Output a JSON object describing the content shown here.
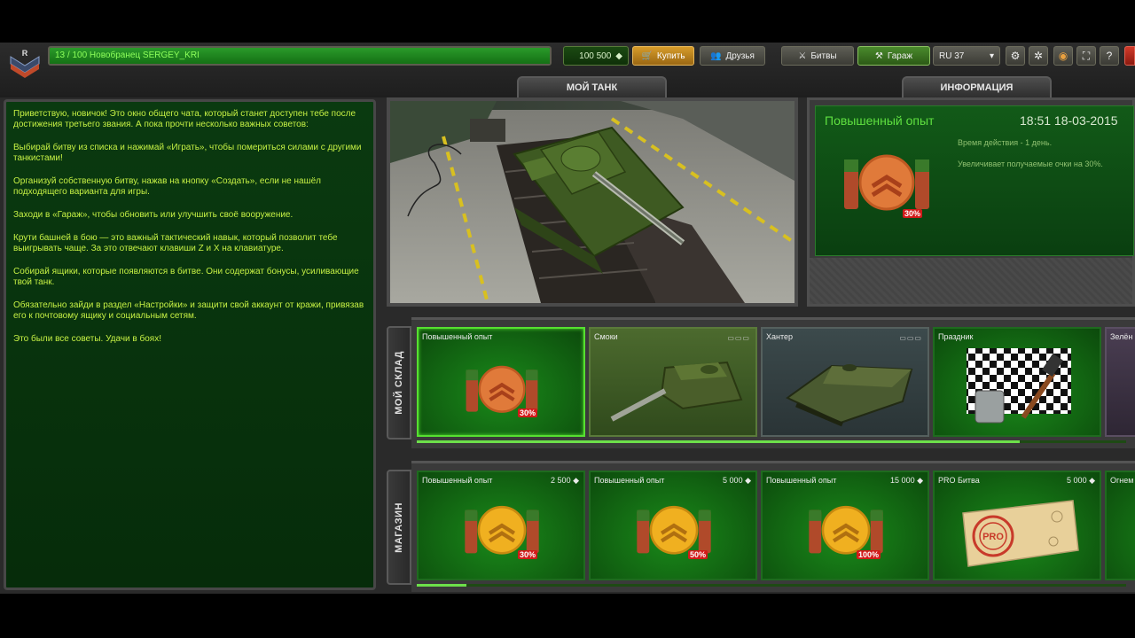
{
  "topbar": {
    "xp_text": "13 / 100   Новобранец SERGEY_KRI",
    "xp_progress": 0.13,
    "crystals": "100 500",
    "crystal_symbol": "◆",
    "buy_label": "Купить",
    "friends_label": "Друзья",
    "battles_label": "Битвы",
    "garage_label": "Гараж",
    "server_label": "RU 37",
    "help_label": "?"
  },
  "chat": {
    "lines": [
      "Приветствую, новичок! Это окно общего чата, который станет доступен тебе после достижения третьего звания. А пока прочти несколько важных советов:",
      "Выбирай битву из списка и нажимай «Играть», чтобы помериться силами с другими танкистами!",
      "Организуй собственную битву, нажав на кнопку «Создать», если не нашёл подходящего варианта для игры.",
      "Заходи в «Гараж», чтобы обновить или улучшить своё вооружение.",
      "Крути башней в бою — это важный тактический навык, который позволит тебе выигрывать чаще. За это отвечают клавиши Z и X на клавиатуре.",
      "Собирай ящики, которые появляются в битве. Они содержат бонусы, усиливающие твой танк.",
      "Обязательно зайди в раздел «Настройки» и защити свой аккаунт от кражи, привязав его к почтовому ящику и социальным сетям.",
      "Это были все советы. Удачи в боях!"
    ]
  },
  "tabs": {
    "my_tank": "МОЙ ТАНК",
    "info": "ИНФОРМАЦИЯ",
    "warehouse": "МОЙ СКЛАД",
    "shop": "МАГАЗИН"
  },
  "info": {
    "title": "Повышенный опыт",
    "time": "18:51  18-03-2015",
    "duration": "Время действия - 1 день.",
    "description": "Увеличивает получаемые очки на 30%.",
    "badge": "30%"
  },
  "warehouse": {
    "items": [
      {
        "name": "Повышенный опыт",
        "badge": "30%"
      },
      {
        "name": "Смоки",
        "dots": "▭▭▭"
      },
      {
        "name": "Хантер",
        "dots": "▭▭▭"
      },
      {
        "name": "Праздник"
      },
      {
        "name": "Зелён"
      }
    ],
    "scroll_progress": 0.85
  },
  "shop": {
    "items": [
      {
        "name": "Повышенный опыт",
        "price": "2 500",
        "badge": "30%"
      },
      {
        "name": "Повышенный опыт",
        "price": "5 000",
        "badge": "50%"
      },
      {
        "name": "Повышенный опыт",
        "price": "15 000",
        "badge": "100%"
      },
      {
        "name": "PRO Битва",
        "price": "5 000"
      },
      {
        "name": "Огнем"
      }
    ],
    "scroll_progress": 0.07
  },
  "colors": {
    "chat_text": "#c5f044",
    "accent_green": "#56e030",
    "buy_orange": "#d79c2a",
    "badge_red": "#d21a1a"
  },
  "icons": [
    "rank-chevron-icon",
    "crystal-icon",
    "cart-icon",
    "friends-icon",
    "battles-icon",
    "garage-icon",
    "dropdown-icon",
    "settings-icon",
    "gear-icon",
    "sound-icon",
    "fullscreen-icon",
    "help-icon",
    "close-icon"
  ]
}
